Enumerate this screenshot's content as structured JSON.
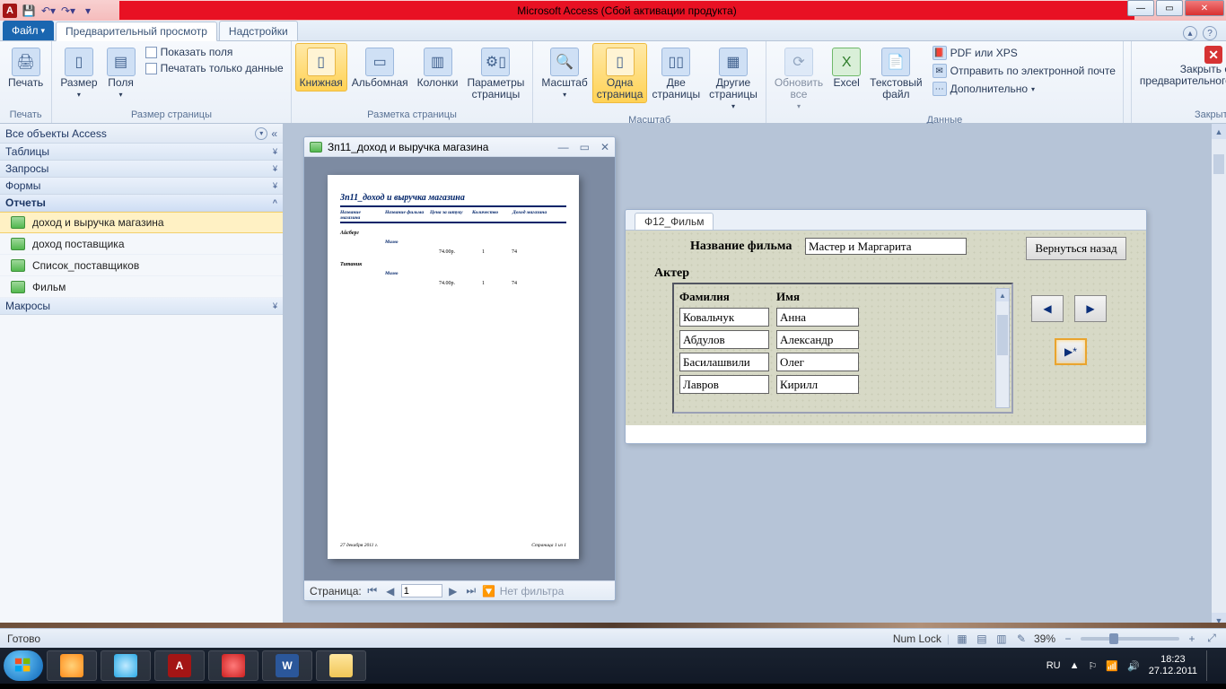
{
  "title": "Microsoft Access (Сбой активации продукта)",
  "tabs": {
    "file": "Файл",
    "preview": "Предварительный просмотр",
    "addins": "Надстройки"
  },
  "ribbon": {
    "print": "Печать",
    "print_grp": "Печать",
    "size": "Размер",
    "margins": "Поля",
    "show_fields": "Показать поля",
    "print_data_only": "Печатать только данные",
    "pagesize_grp": "Размер страницы",
    "portrait": "Книжная",
    "landscape": "Альбомная",
    "columns": "Колонки",
    "pagesetup": "Параметры\nстраницы",
    "layout_grp": "Разметка страницы",
    "zoom": "Масштаб",
    "one_page": "Одна\nстраница",
    "two_pages": "Две\nстраницы",
    "more_pages": "Другие\nстраницы",
    "zoom_grp": "Масштаб",
    "refresh": "Обновить\nвсе",
    "excel": "Excel",
    "textfile": "Текстовый\nфайл",
    "pdf_xps": "PDF или XPS",
    "email": "Отправить по электронной почте",
    "more": "Дополнительно",
    "data_grp": "Данные",
    "close": "Закрыть окно\nпредварительного просмотра",
    "close_grp": "Закрыть"
  },
  "nav": {
    "header": "Все объекты Access",
    "tables": "Таблицы",
    "queries": "Запросы",
    "forms": "Формы",
    "reports": "Отчеты",
    "macros": "Макросы",
    "items": [
      "доход и выручка магазина",
      "доход поставщика",
      "Список_поставщиков",
      "Фильм"
    ]
  },
  "report": {
    "title": "Зп11_доход и выручка магазина",
    "heading": "Зп11_доход и выручка магазина",
    "cols": [
      "Название магазина",
      "Название фильма",
      "Цена за штуку",
      "Количество",
      "Доход магазина"
    ],
    "g1": "Айсберг",
    "f1": "Мимо",
    "v1a": "74.00р.",
    "v1b": "1",
    "v1c": "74",
    "g2": "Титаник",
    "f2": "Мимо",
    "v2a": "74.00р.",
    "v2b": "1",
    "v2c": "74",
    "date": "27 декабря 2011 г.",
    "page": "Страница 1 из 1",
    "pager_label": "Страница:",
    "pager_val": "1",
    "no_filter": "Нет фильтра"
  },
  "form": {
    "tab": "Ф12_Фильм",
    "name_lbl": "Название фильма",
    "name_val": "Мастер и Маргарита",
    "back": "Вернуться назад",
    "actor": "Актер",
    "col1": "Фамилия",
    "col2": "Имя",
    "rows": [
      {
        "s": "Ковальчук",
        "n": "Анна"
      },
      {
        "s": "Абдулов",
        "n": "Александр"
      },
      {
        "s": "Басилашвили",
        "n": "Олег"
      },
      {
        "s": "Лавров",
        "n": "Кирилл"
      }
    ]
  },
  "status": {
    "ready": "Готово",
    "numlock": "Num Lock",
    "zoom": "39%"
  },
  "tray": {
    "lang": "RU",
    "time": "18:23",
    "date": "27.12.2011"
  }
}
